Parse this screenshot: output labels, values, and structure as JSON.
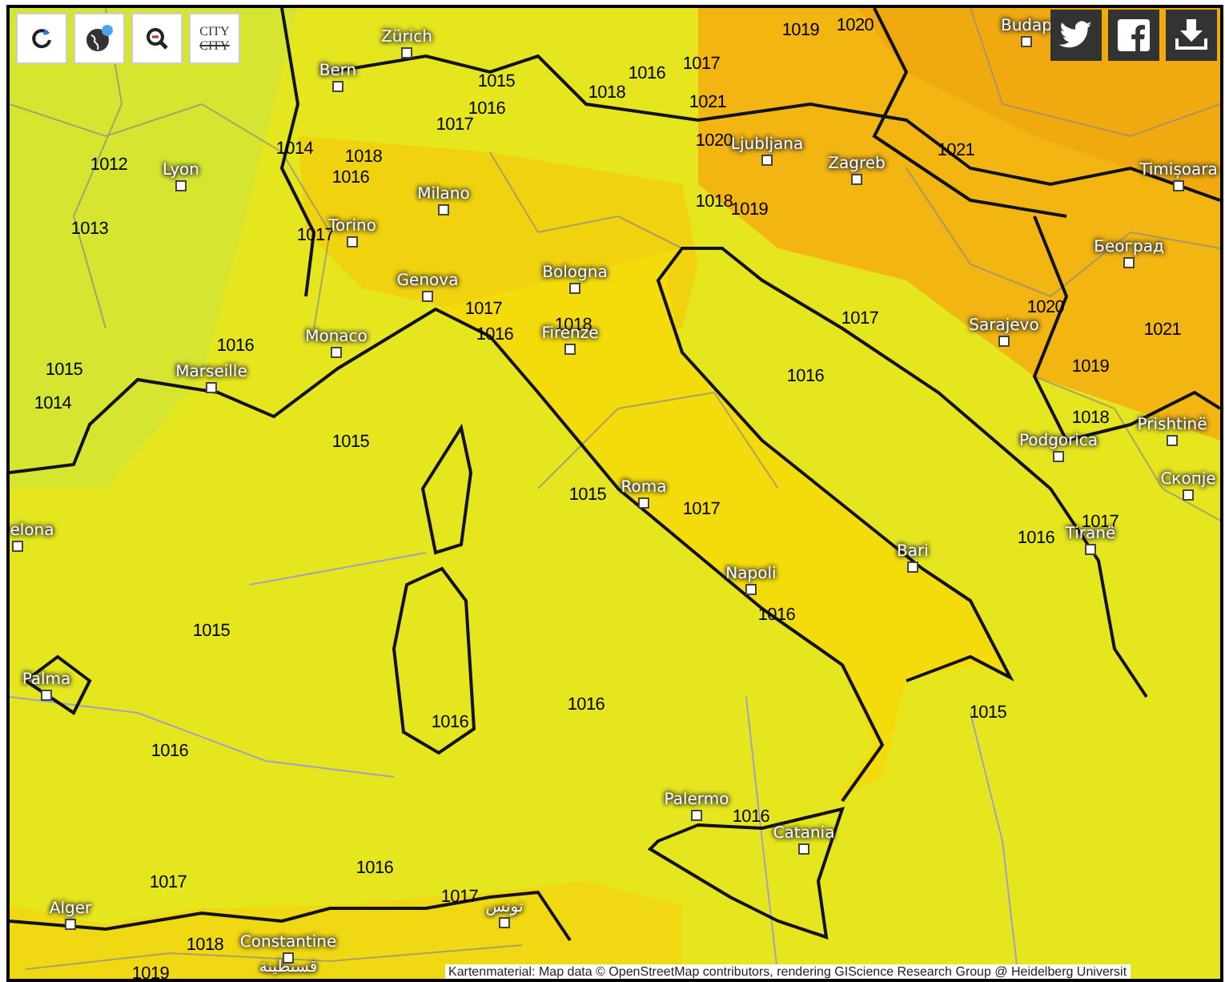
{
  "toolbar": {
    "buttons": [
      {
        "kind": "refresh"
      },
      {
        "kind": "globe"
      },
      {
        "kind": "zoom_out"
      },
      {
        "kind": "city",
        "label": "CITY",
        "struck_label": "CITY"
      }
    ]
  },
  "share_buttons": [
    {
      "kind": "twitter"
    },
    {
      "kind": "facebook"
    },
    {
      "kind": "download"
    }
  ],
  "cities": [
    {
      "name": "Zürich"
    },
    {
      "name": "Bern"
    },
    {
      "name": "Lyon"
    },
    {
      "name": "Milano"
    },
    {
      "name": "Torino"
    },
    {
      "name": "Genova"
    },
    {
      "name": "Bologna"
    },
    {
      "name": "Monaco"
    },
    {
      "name": "Firenze"
    },
    {
      "name": "Marseille"
    },
    {
      "name": "Ljubljana"
    },
    {
      "name": "Zagreb"
    },
    {
      "name": "Budap"
    },
    {
      "name": "Timișoara"
    },
    {
      "name": "Београд"
    },
    {
      "name": "Sarajevo"
    },
    {
      "name": "Podgorica"
    },
    {
      "name": "Prishtinë"
    },
    {
      "name": "Скопје"
    },
    {
      "name": "Roma"
    },
    {
      "name": "Bari"
    },
    {
      "name": "Tiranë"
    },
    {
      "name": "Napoli"
    },
    {
      "name": "elona"
    },
    {
      "name": "Palma"
    },
    {
      "name": "Palermo"
    },
    {
      "name": "Catania"
    },
    {
      "name": "Alger"
    },
    {
      "name": "Constantine",
      "local_name": "قسنطينة"
    },
    {
      "name": "تونس"
    }
  ],
  "isobar_labels": [
    "1012",
    "1013",
    "1014",
    "1018",
    "1016",
    "1017",
    "1015",
    "1016",
    "1017",
    "1016",
    "1017",
    "1019",
    "1020",
    "1018",
    "1021",
    "1020",
    "1018",
    "1019",
    "1021",
    "1017",
    "1016",
    "1018",
    "1016",
    "1015",
    "1014",
    "1015",
    "1015",
    "1017",
    "1016",
    "1017",
    "1020",
    "1021",
    "1019",
    "1018",
    "1017",
    "1016",
    "1016",
    "1015",
    "1016",
    "1016",
    "1016",
    "1015",
    "1016",
    "1017",
    "1016",
    "1017",
    "1018",
    "1019"
  ],
  "attribution": "Kartenmaterial: Map data © OpenStreetMap contributors, rendering GIScience Research Group @ Heidelberg Universit"
}
